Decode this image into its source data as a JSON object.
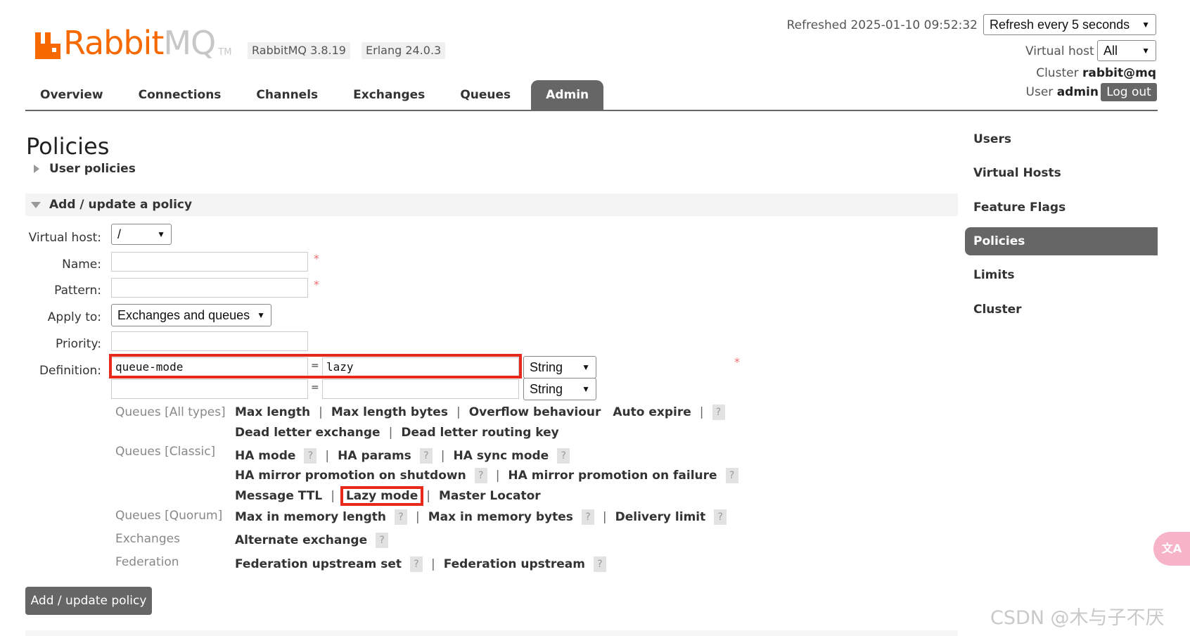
{
  "header": {
    "brand_rabbit": "Rabbit",
    "brand_mq": "MQ",
    "brand_tm": "TM",
    "rabbitmq_version": "RabbitMQ 3.8.19",
    "erlang_version": "Erlang 24.0.3",
    "refreshed": "Refreshed 2025-01-10 09:52:32",
    "refresh_select": "Refresh every 5 seconds",
    "virtual_host_label": "Virtual host",
    "virtual_host_value": "All",
    "cluster_label": "Cluster",
    "cluster_value": "rabbit@mq",
    "user_label": "User",
    "user_value": "admin",
    "logout_label": "Log out"
  },
  "nav": {
    "tabs": [
      "Overview",
      "Connections",
      "Channels",
      "Exchanges",
      "Queues",
      "Admin"
    ],
    "active": "Admin"
  },
  "main": {
    "title": "Policies",
    "user_policies": "User policies",
    "section_title": "Add / update a policy",
    "form": {
      "virtual_host_label": "Virtual host:",
      "virtual_host_value": "/",
      "name_label": "Name:",
      "name_value": "",
      "pattern_label": "Pattern:",
      "pattern_value": "",
      "apply_to_label": "Apply to:",
      "apply_to_value": "Exchanges and queues",
      "priority_label": "Priority:",
      "priority_value": "",
      "definition_label": "Definition:",
      "required_mark": "*",
      "equals": "=",
      "definitions": [
        {
          "key": "queue-mode",
          "value": "lazy",
          "type": "String"
        },
        {
          "key": "",
          "value": "",
          "type": "String"
        }
      ]
    },
    "help": {
      "qmark": "?",
      "sep": "|",
      "queues_all_label": "Queues [All types]",
      "queues_all_row1": [
        "Max length",
        "Max length bytes",
        "Overflow behaviour",
        "Auto expire"
      ],
      "queues_all_row2": [
        "Dead letter exchange",
        "Dead letter routing key"
      ],
      "queues_classic_label": "Queues [Classic]",
      "queues_classic_row1": [
        "HA mode",
        "HA params",
        "HA sync mode"
      ],
      "queues_classic_row2": [
        "HA mirror promotion on shutdown",
        "HA mirror promotion on failure"
      ],
      "queues_classic_row3": [
        "Message TTL",
        "Lazy mode",
        "Master Locator"
      ],
      "queues_quorum_label": "Queues [Quorum]",
      "queues_quorum_row1": [
        "Max in memory length",
        "Max in memory bytes",
        "Delivery limit"
      ],
      "exchanges_label": "Exchanges",
      "exchanges_row1": [
        "Alternate exchange"
      ],
      "federation_label": "Federation",
      "federation_row1": [
        "Federation upstream set",
        "Federation upstream"
      ]
    },
    "submit_label": "Add / update policy"
  },
  "sidebar": {
    "items": [
      "Users",
      "Virtual Hosts",
      "Feature Flags",
      "Policies",
      "Limits",
      "Cluster"
    ],
    "active": "Policies"
  },
  "overlay": {
    "translate_label": "文A",
    "watermark": "CSDN @木与子不厌"
  }
}
